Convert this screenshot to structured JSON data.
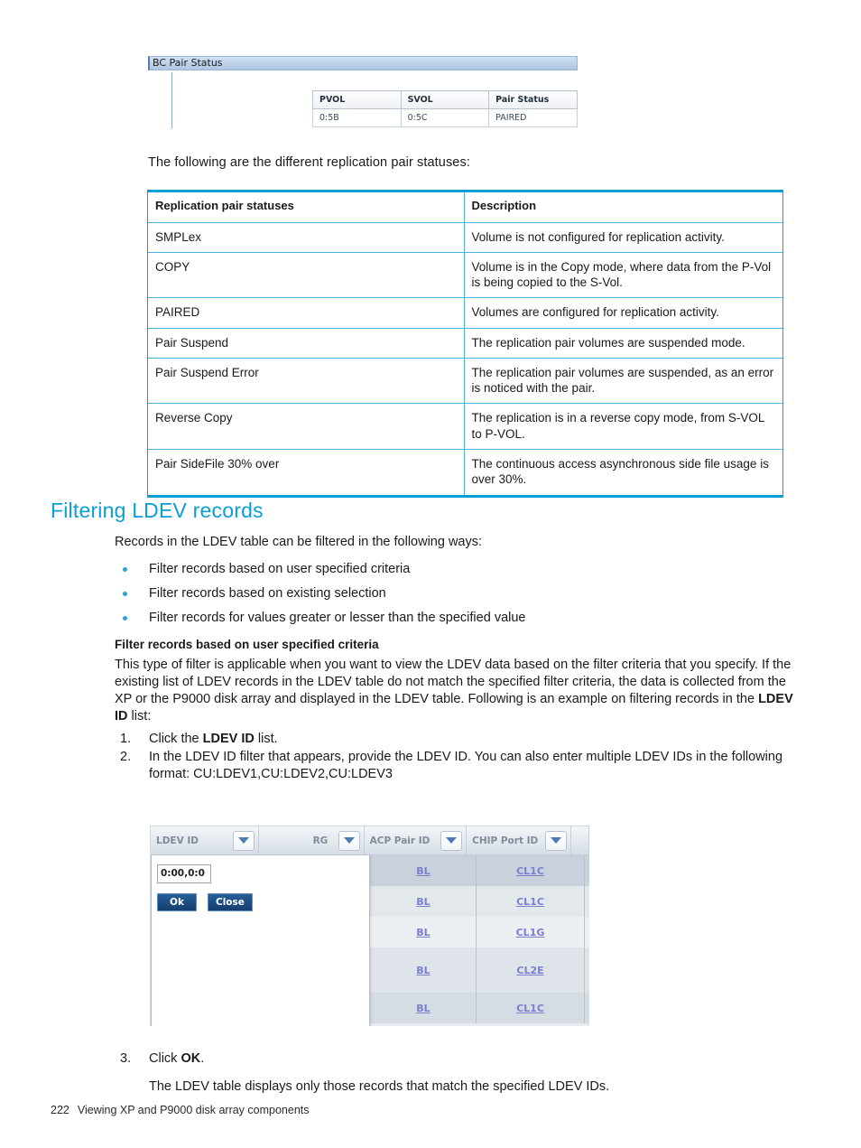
{
  "bc_screenshot": {
    "title": "BC Pair Status",
    "table": {
      "headers": [
        "PVOL",
        "SVOL",
        "Pair Status"
      ],
      "rows": [
        [
          "0:5B",
          "0:5C",
          "PAIRED"
        ]
      ]
    }
  },
  "lead_text": "The following are the different replication pair statuses:",
  "replication_table": {
    "headers": [
      "Replication pair statuses",
      "Description"
    ],
    "rows": [
      [
        "SMPLex",
        "Volume is not configured for replication activity."
      ],
      [
        "COPY",
        "Volume is in the Copy mode, where data from the P-Vol is being copied to the S-Vol."
      ],
      [
        "PAIRED",
        "Volumes are configured for replication activity."
      ],
      [
        "Pair Suspend",
        "The replication pair volumes are suspended mode."
      ],
      [
        "Pair Suspend Error",
        "The replication pair volumes are suspended, as an error is noticed with the pair."
      ],
      [
        "Reverse Copy",
        "The replication is in a reverse copy mode, from S-VOL to P-VOL."
      ],
      [
        "Pair SideFile 30% over",
        "The continuous access asynchronous side file usage is over 30%."
      ]
    ]
  },
  "section": {
    "heading": "Filtering LDEV records",
    "intro": "Records in the LDEV table can be filtered in the following ways:",
    "bullets": [
      "Filter records based on user specified criteria",
      "Filter records based on existing selection",
      "Filter records for values greater or lesser than the specified value"
    ],
    "subheading": "Filter records based on user specified criteria",
    "paragraph_part1": "This type of filter is applicable when you want to view the LDEV data based on the filter criteria that you specify. If the existing list of LDEV records in the LDEV table do not match the specified filter criteria, the data is collected from the XP or the P9000 disk array and displayed in the LDEV table. Following is an example on filtering records in the ",
    "paragraph_bold": "LDEV ID",
    "paragraph_part2": " list:",
    "steps": [
      {
        "num": "1.",
        "part1": "Click the ",
        "bold": "LDEV ID",
        "part2": " list."
      },
      {
        "num": "2.",
        "part1": "In the LDEV ID filter that appears, provide the LDEV ID. You can also enter multiple LDEV IDs in the following format: CU:LDEV1,CU:LDEV2,CU:LDEV3",
        "bold": "",
        "part2": ""
      },
      {
        "num": "3.",
        "part1": "Click ",
        "bold": "OK",
        "part2": "."
      }
    ],
    "step3_result": "The LDEV table displays only those records that match the specified LDEV IDs."
  },
  "ldev_screenshot": {
    "columns": [
      "LDEV ID",
      "RG",
      "ACP Pair ID",
      "CHIP Port ID"
    ],
    "filter": {
      "input_value": "0:00,0:0",
      "ok_label": "Ok",
      "close_label": "Close"
    },
    "rows": [
      {
        "acp_pair_id": "BL",
        "chip_port_id": "CL1C"
      },
      {
        "acp_pair_id": "BL",
        "chip_port_id": "CL1C"
      },
      {
        "acp_pair_id": "BL",
        "chip_port_id": "CL1G"
      },
      {
        "acp_pair_id": "BL",
        "chip_port_id": "CL2E"
      },
      {
        "acp_pair_id": "BL",
        "chip_port_id": "CL1C"
      }
    ]
  },
  "footer": {
    "page_number": "222",
    "text": "Viewing XP and P9000 disk array components"
  },
  "colors": {
    "accent_blue": "#0b9dd6",
    "table_border_blue": "#4ab4e0",
    "bullet_blue": "#2f9fd4",
    "link_purple": "#7b7fd0"
  }
}
